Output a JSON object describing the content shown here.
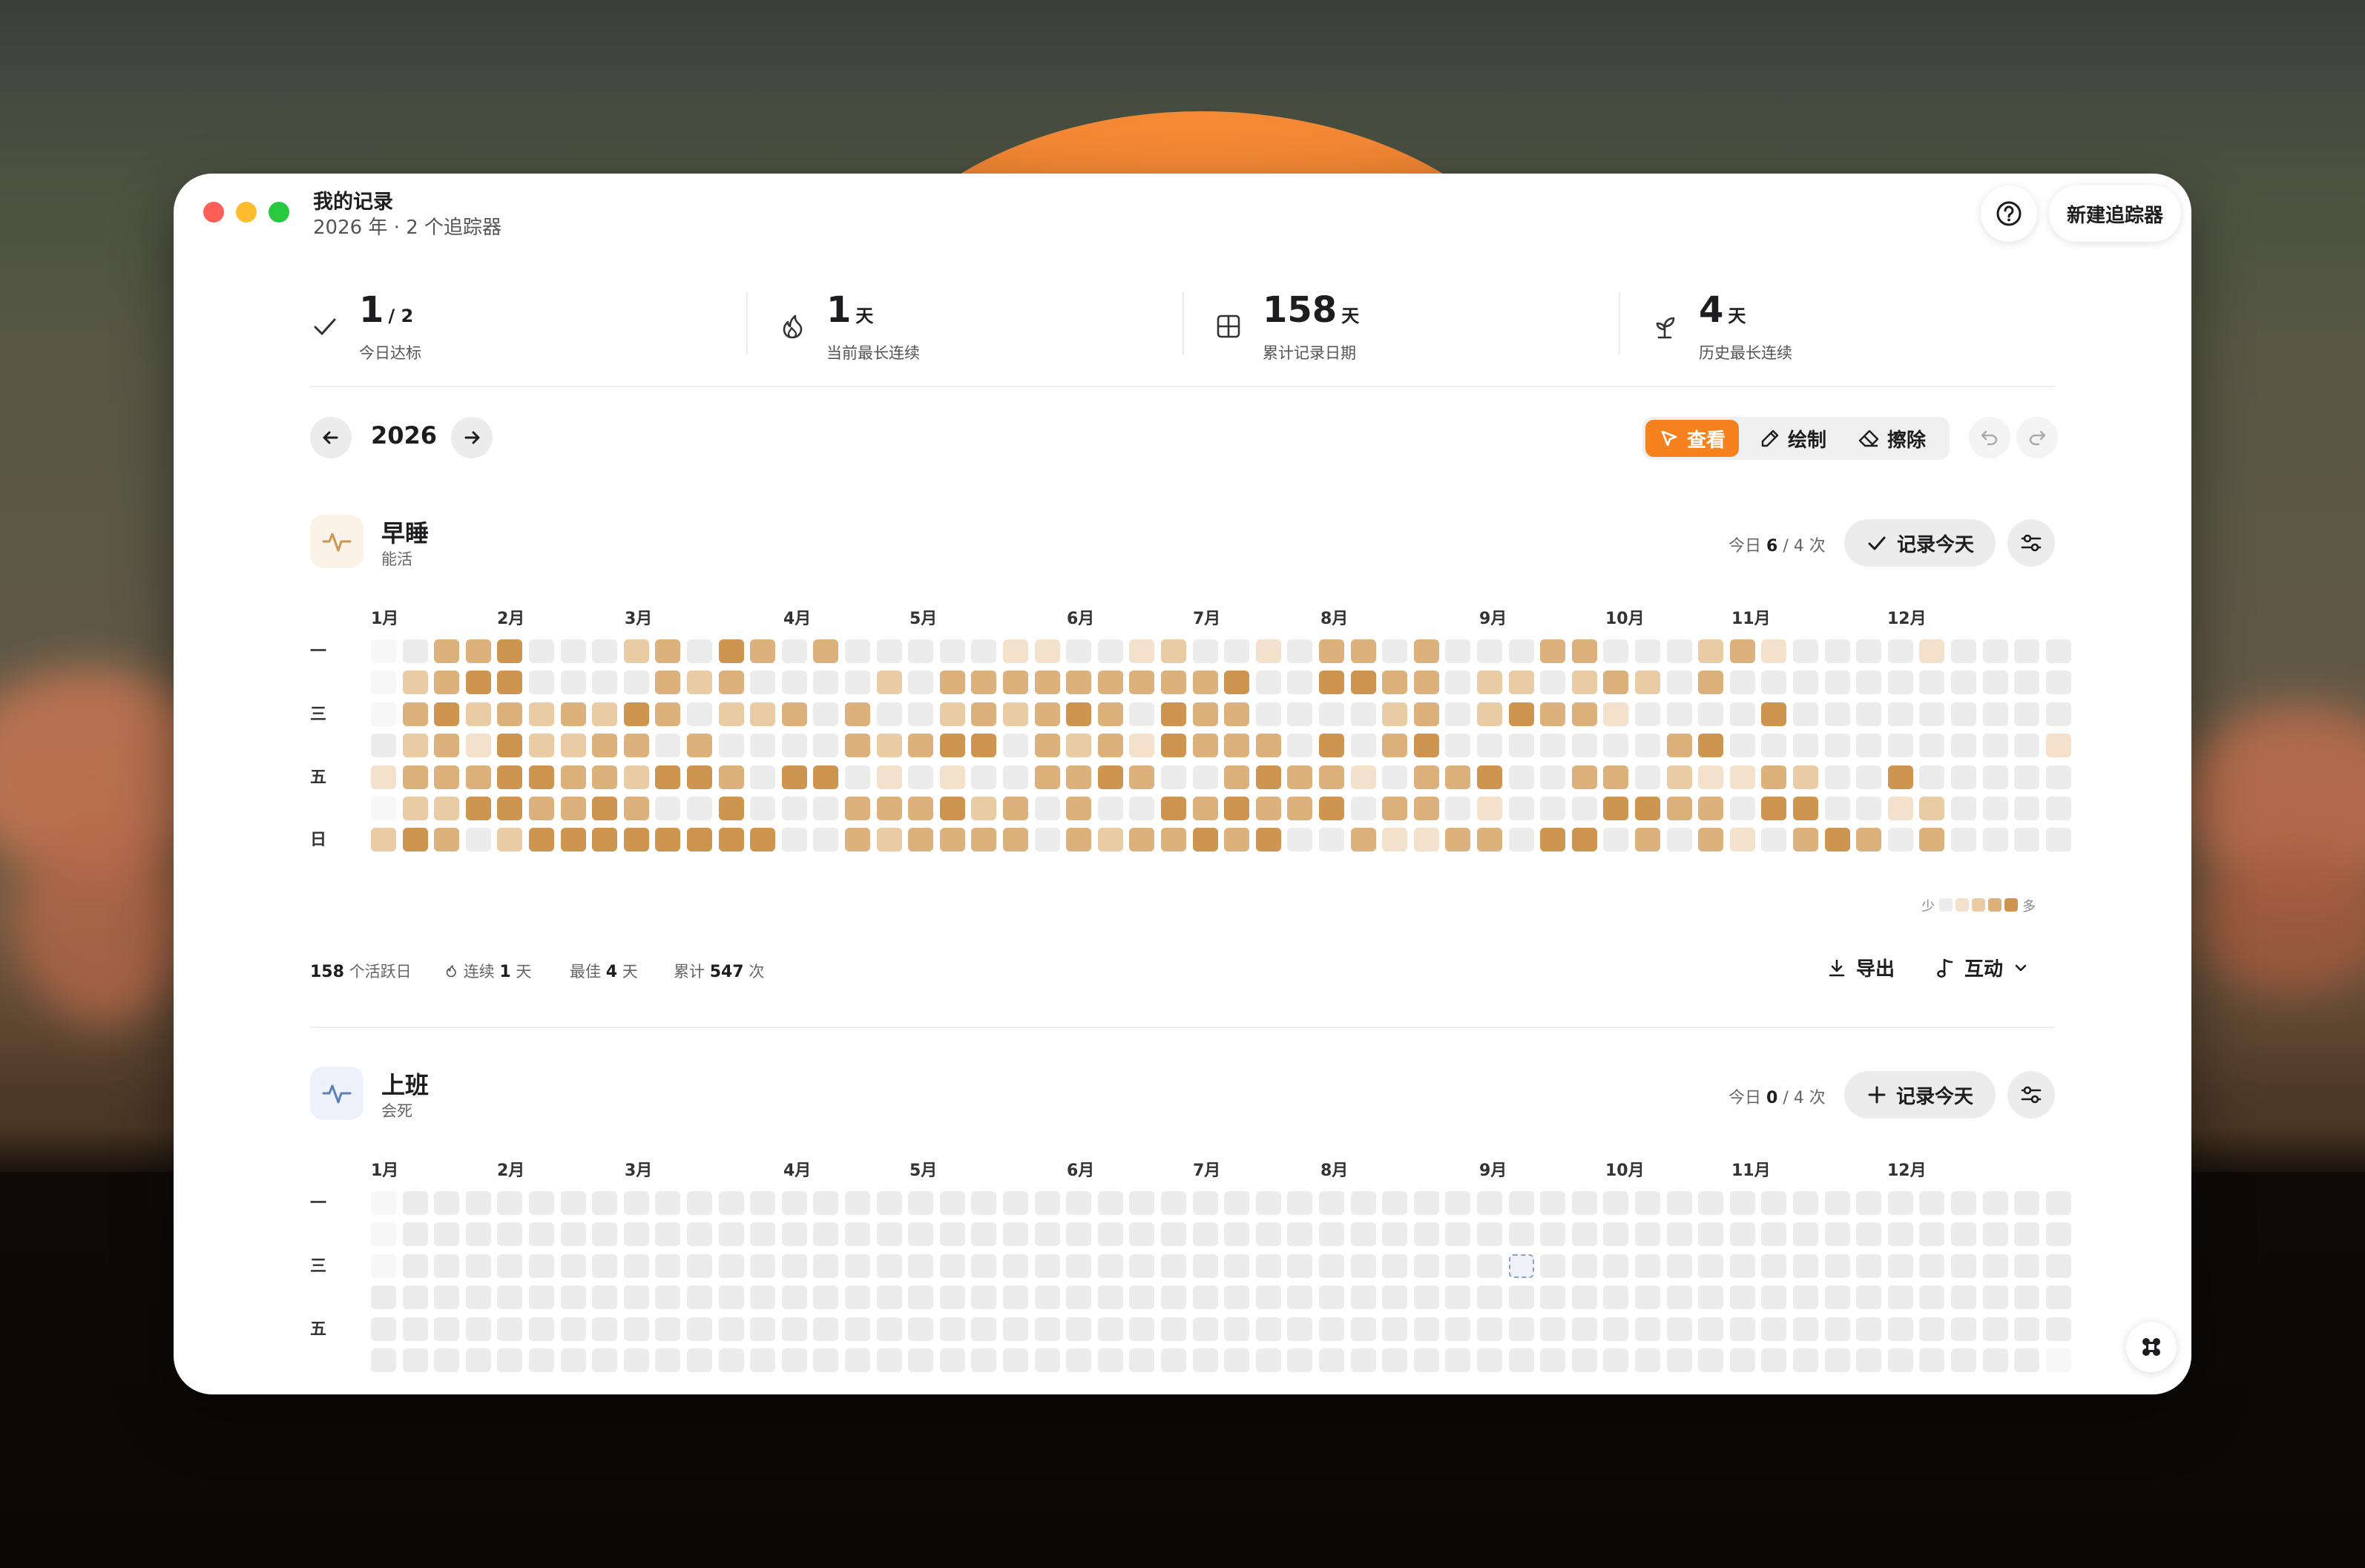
{
  "app": {
    "title": "我的记录",
    "subtitle": "2026 年 · 2 个追踪器",
    "new_tracker_label": "新建追踪器"
  },
  "stats": [
    {
      "value": "1",
      "unit": "/ 2",
      "label": "今日达标",
      "icon": "check-icon"
    },
    {
      "value": "1",
      "unit": "天",
      "label": "当前最长连续",
      "icon": "flame-icon"
    },
    {
      "value": "158",
      "unit": "天",
      "label": "累计记录日期",
      "icon": "grid-icon"
    },
    {
      "value": "4",
      "unit": "天",
      "label": "历史最长连续",
      "icon": "sprout-icon"
    }
  ],
  "year_nav": {
    "year": "2026"
  },
  "modes": [
    {
      "label": "查看",
      "icon": "cursor-icon",
      "active": true
    },
    {
      "label": "绘制",
      "icon": "pencil-icon",
      "active": false
    },
    {
      "label": "擦除",
      "icon": "eraser-icon",
      "active": false
    }
  ],
  "months": [
    "1月",
    "2月",
    "3月",
    "4月",
    "5月",
    "6月",
    "7月",
    "8月",
    "9月",
    "10月",
    "11月",
    "12月"
  ],
  "weekday_labels": [
    "一",
    "三",
    "五",
    "日"
  ],
  "colors": {
    "accent": "#f5821f",
    "empty": "#ececec",
    "faint": "#f7f7f7",
    "levels": [
      "#ececec",
      "#f3e1cc",
      "#e9cba4",
      "#dcb17c",
      "#cd9550"
    ]
  },
  "trackers": [
    {
      "name": "早睡",
      "subtitle": "能活",
      "icon": "pulse-icon",
      "icon_color": "#cd9550",
      "today_prefix": "今日",
      "today_done": "6",
      "today_goal": "/ 4 次",
      "log_label": "记录今天",
      "log_icon": "check-icon",
      "heatmap_rows": [
        "f0334000230430300000110012001033030003300023100001000000000000000f",
        "f23440000323000020333333333400443302202320300000000000000000000000",
        "f34232324302230300232343043300002302433100004000000000000000000000",
        "023142233030000323440323143330403400000003400000000001000001000000",
        "133344332443044010100334300343310334003302113200400000000000000f0f",
        "f22443343004000333423030043433403301000443304400120000000000000f00",
        "24302444444440032333303233434003113304403031034303000000000000000f"
      ],
      "legend_less": "少",
      "legend_more": "多",
      "footer": {
        "active_days": "158",
        "active_days_label": "个活跃日",
        "streak_label": "连续",
        "streak": "1",
        "streak_unit": "天",
        "best_label": "最佳",
        "best": "4",
        "best_unit": "天",
        "total_label": "累计",
        "total": "547",
        "total_unit": "次",
        "export_label": "导出",
        "interact_label": "互动"
      }
    },
    {
      "name": "上班",
      "subtitle": "会死",
      "icon": "pulse-icon",
      "icon_color": "#5b7fb8",
      "today_prefix": "今日",
      "today_done": "0",
      "today_goal": "/ 4 次",
      "log_label": "记录今天",
      "log_icon": "plus-icon"
    }
  ]
}
